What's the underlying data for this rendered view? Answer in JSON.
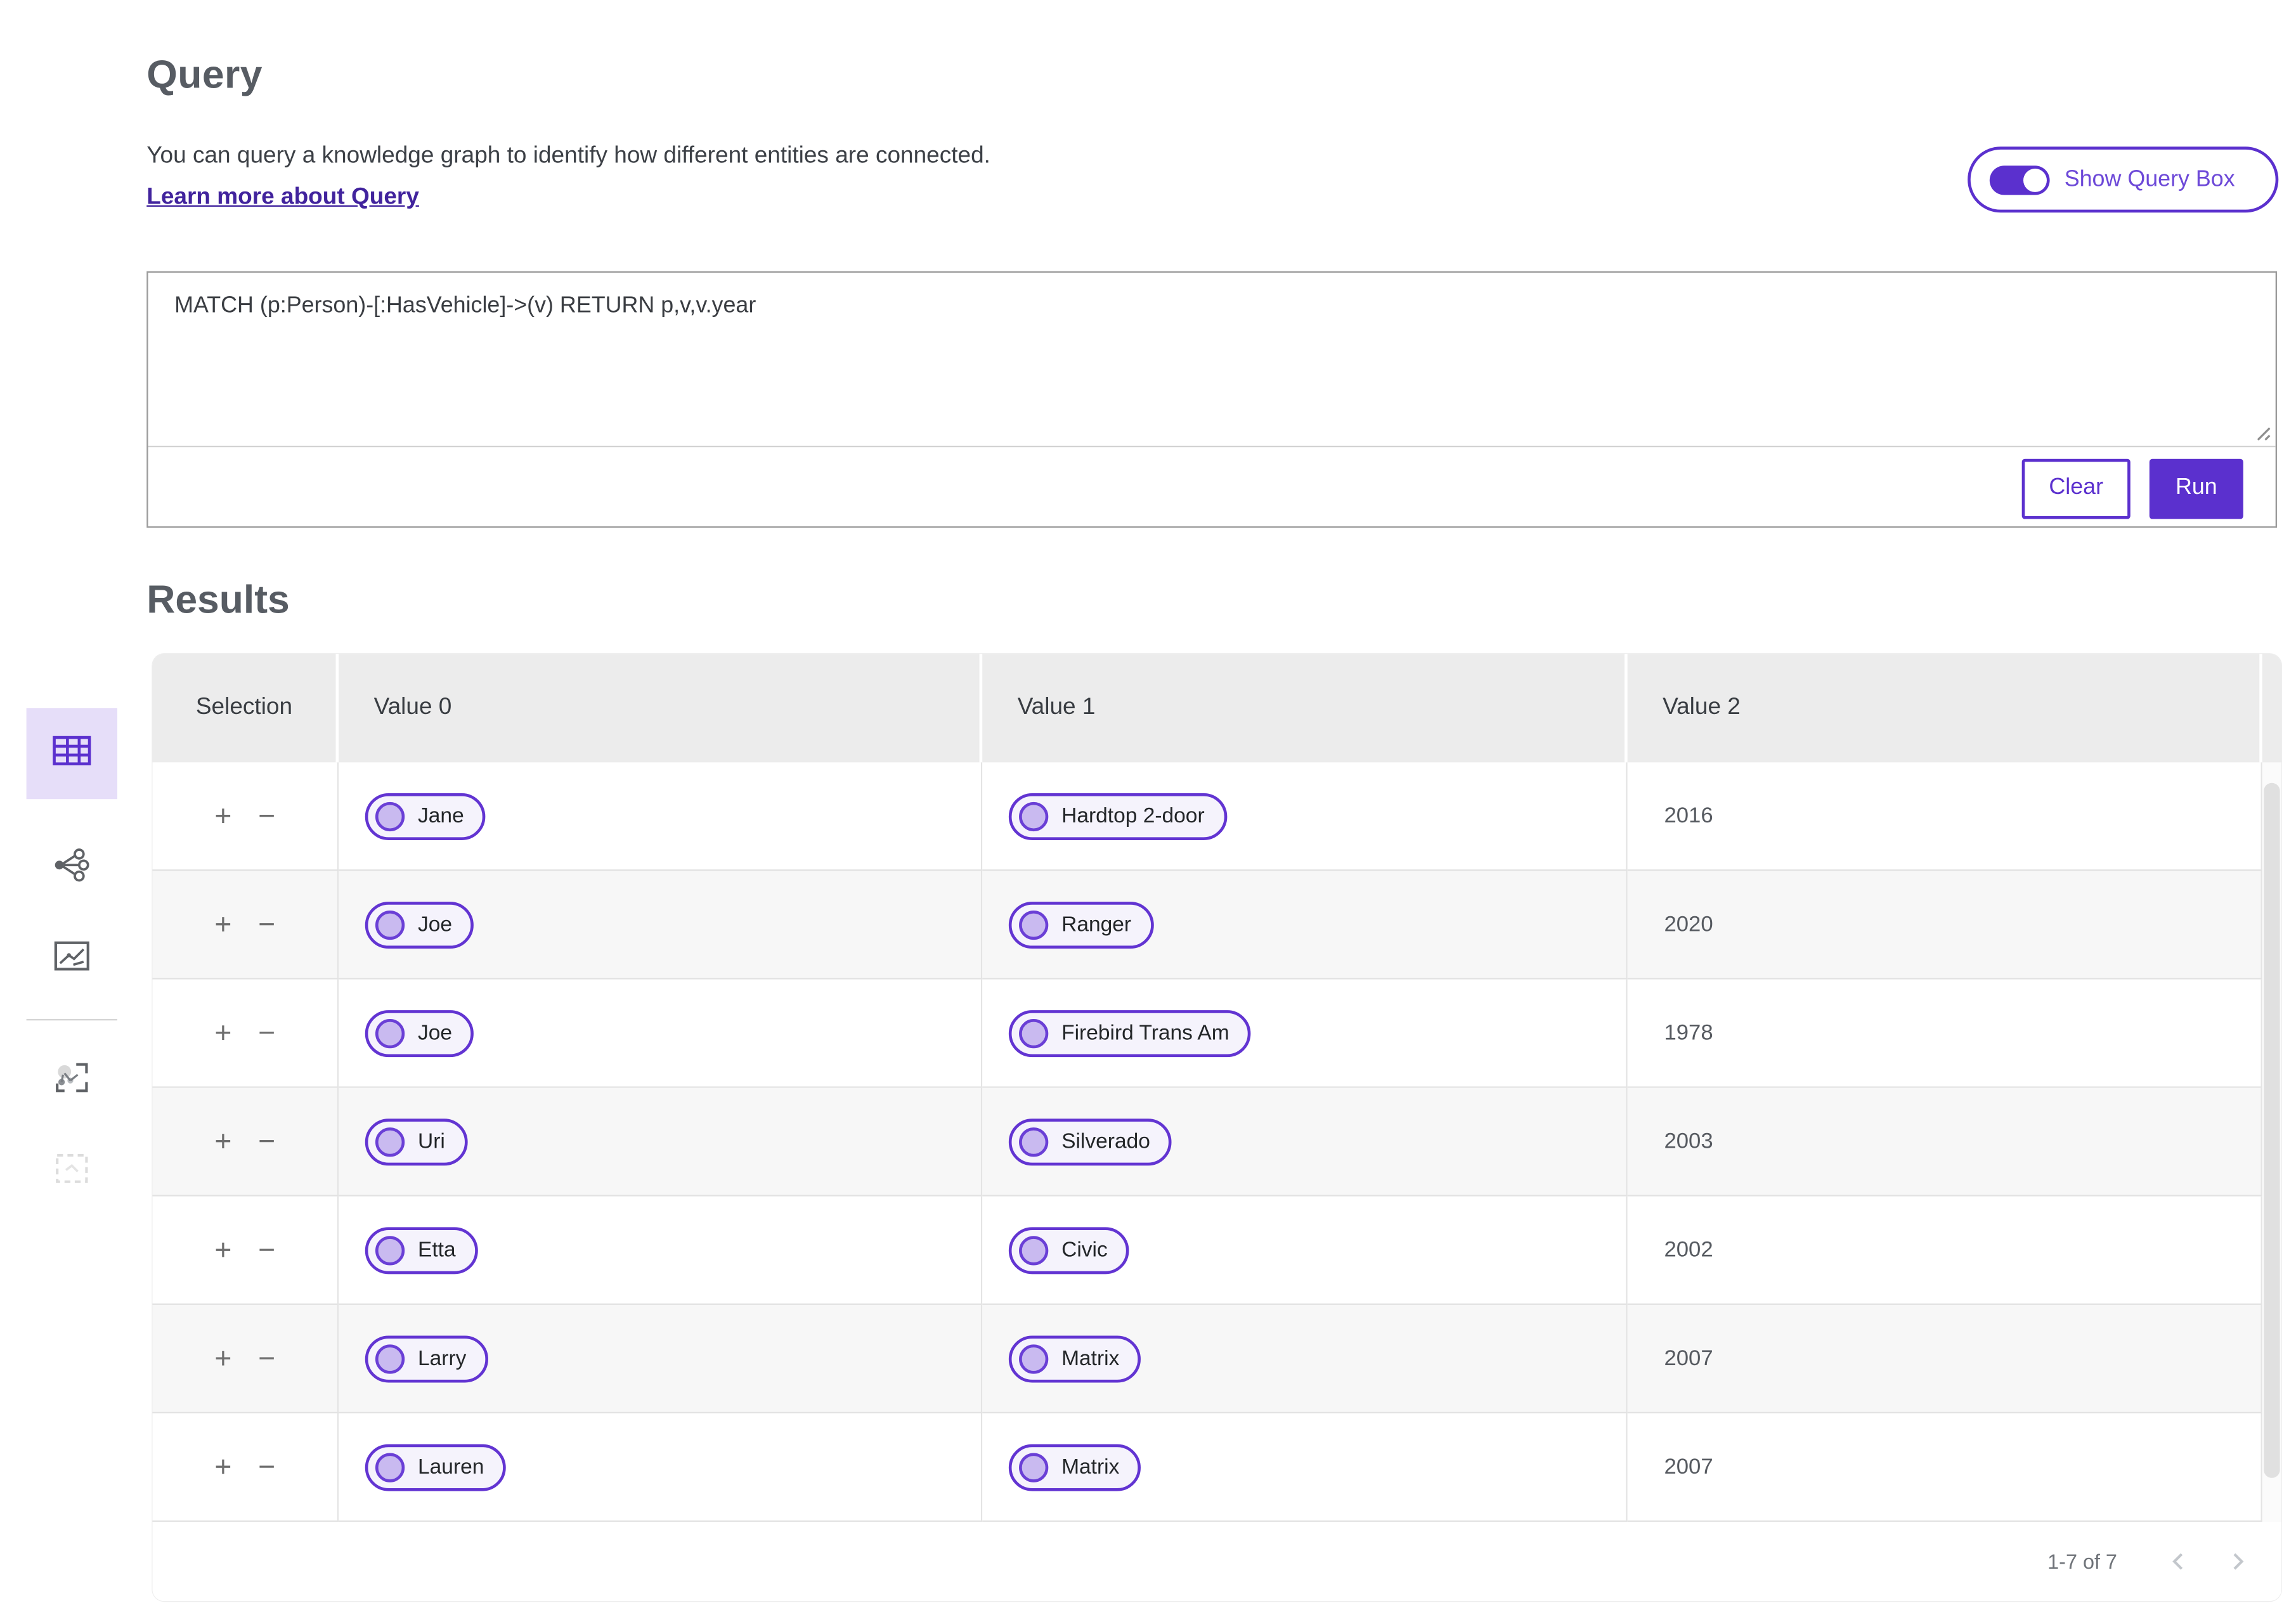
{
  "header": {
    "title": "Query",
    "description": "You can query a knowledge graph to identify how different entities are connected.",
    "learn_more_label": "Learn more about Query",
    "toggle_label": "Show Query Box",
    "toggle_state": "on"
  },
  "query_box": {
    "value": "MATCH (p:Person)-[:HasVehicle]->(v) RETURN p,v,v.year",
    "clear_label": "Clear",
    "run_label": "Run"
  },
  "sidebar": {
    "items": [
      {
        "name": "table-view",
        "icon": "table-icon",
        "selected": true
      },
      {
        "name": "graph-view",
        "icon": "network-icon",
        "selected": false
      },
      {
        "name": "chart-view",
        "icon": "line-chart-icon",
        "selected": false
      },
      {
        "name": "expand-graph-view",
        "icon": "graph-frame-icon",
        "selected": false
      },
      {
        "name": "selection-view",
        "icon": "dashed-box-icon",
        "selected": false,
        "disabled": true
      }
    ]
  },
  "results": {
    "title": "Results",
    "columns": [
      "Selection",
      "Value 0",
      "Value 1",
      "Value 2"
    ],
    "add_label": "+",
    "remove_label": "−",
    "rows": [
      {
        "value0": "Jane",
        "value1": "Hardtop 2-door",
        "value2": "2016"
      },
      {
        "value0": "Joe",
        "value1": "Ranger",
        "value2": "2020"
      },
      {
        "value0": "Joe",
        "value1": "Firebird Trans Am",
        "value2": "1978"
      },
      {
        "value0": "Uri",
        "value1": "Silverado",
        "value2": "2003"
      },
      {
        "value0": "Etta",
        "value1": "Civic",
        "value2": "2002"
      },
      {
        "value0": "Larry",
        "value1": "Matrix",
        "value2": "2007"
      },
      {
        "value0": "Lauren",
        "value1": "Matrix",
        "value2": "2007"
      }
    ],
    "pagination": {
      "label": "1-7 of 7"
    }
  },
  "colors": {
    "accent_purple": "#5b30ce",
    "link_purple": "#41239d",
    "chip_border": "#6234d2",
    "chip_fill": "#f5f3fc",
    "chip_dot": "#c9baf0",
    "selected_tool_bg": "#e6def9",
    "table_header_bg": "#ececec",
    "zebra_row_bg": "#f7f7f7"
  }
}
